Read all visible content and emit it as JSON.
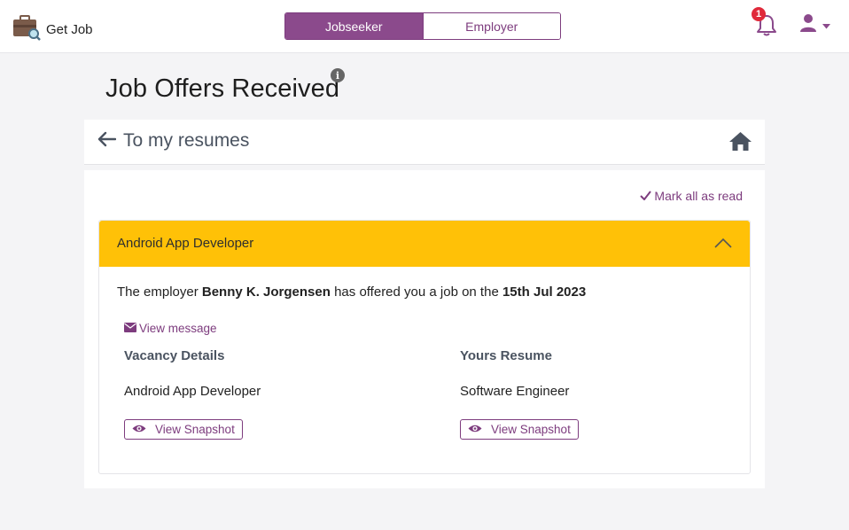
{
  "header": {
    "app_name": "Get Job",
    "roles": [
      {
        "label": "Jobseeker",
        "active": true
      },
      {
        "label": "Employer",
        "active": false
      }
    ],
    "notification_count": "1"
  },
  "page": {
    "title": "Job Offers Received",
    "info_glyph": "i",
    "back_label": "To my resumes",
    "mark_all_label": "Mark all as read"
  },
  "offer": {
    "title": "Android App Developer",
    "sentence_prefix": "The employer ",
    "employer": "Benny K. Jorgensen",
    "sentence_middle": " has offered you a job on the ",
    "date": "15th Jul 2023",
    "view_message_label": "View message",
    "vacancy_heading": "Vacancy Details",
    "vacancy_value": "Android App Developer",
    "resume_heading": "Yours Resume",
    "resume_value": "Software Engineer",
    "snapshot_label": "View Snapshot"
  },
  "colors": {
    "brand_purple": "#8b4a8c",
    "accent_yellow": "#ffc107",
    "badge_red": "#e0293a"
  },
  "icons": [
    "briefcase-search-icon",
    "bell-icon",
    "user-icon",
    "caret-down-icon",
    "info-icon",
    "arrow-left-icon",
    "home-icon",
    "check-icon",
    "chevron-up-icon",
    "envelope-icon",
    "eye-icon"
  ]
}
